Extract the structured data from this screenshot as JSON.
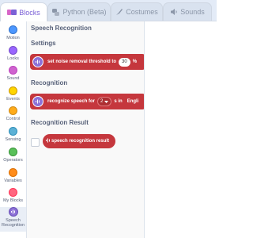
{
  "tabs": [
    {
      "label": "Blocks",
      "icon": "code-icon"
    },
    {
      "label": "Python (Beta)",
      "icon": "python-icon"
    },
    {
      "label": "Costumes",
      "icon": "brush-icon"
    },
    {
      "label": "Sounds",
      "icon": "speaker-icon"
    }
  ],
  "categories": [
    {
      "label": "Motion",
      "color": "#4c97ff"
    },
    {
      "label": "Looks",
      "color": "#9966ff"
    },
    {
      "label": "Sound",
      "color": "#cf63cf"
    },
    {
      "label": "Events",
      "color": "#ffd500"
    },
    {
      "label": "Control",
      "color": "#ffab19"
    },
    {
      "label": "Sensing",
      "color": "#5cb1d6"
    },
    {
      "label": "Operators",
      "color": "#59c059"
    },
    {
      "label": "Variables",
      "color": "#ff8c1a"
    },
    {
      "label": "My Blocks",
      "color": "#ff6680"
    },
    {
      "label": "Speech Recognition",
      "color": "#8b6fd6",
      "selected": true
    }
  ],
  "palette": {
    "title": "Speech Recognition",
    "settings_heading": "Settings",
    "noise_block": {
      "text": "set noise removal threshold to",
      "value": "30",
      "unit": "%"
    },
    "recognition_heading": "Recognition",
    "recognize_block": {
      "text": "recognize speech for",
      "seconds": "2",
      "unit": "s in",
      "language": "Engli"
    },
    "result_heading": "Recognition Result",
    "result_reporter": {
      "text": "speech recognition result"
    }
  },
  "colors": {
    "extension_block": "#c5373d",
    "accent": "#7a5fd6"
  }
}
